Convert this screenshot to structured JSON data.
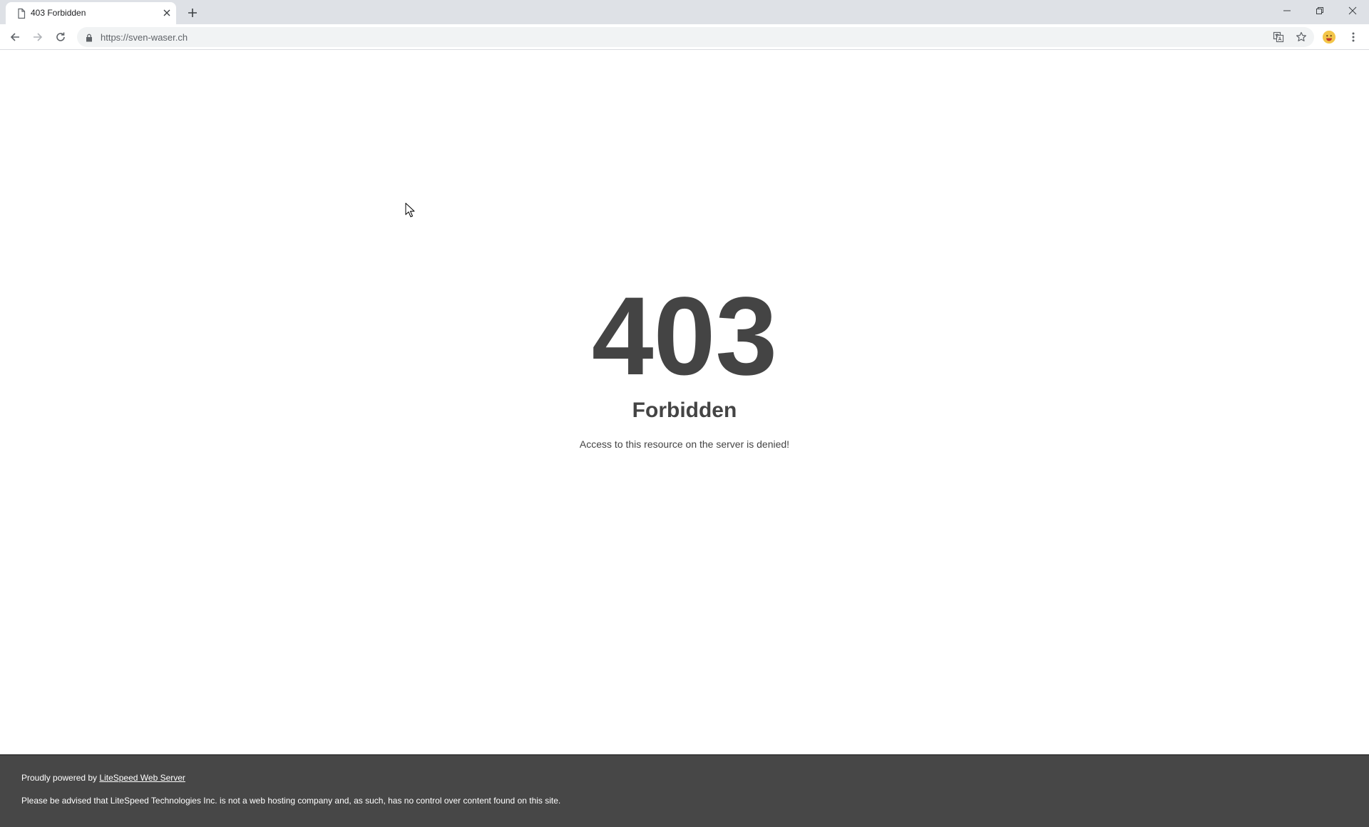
{
  "browser": {
    "tab": {
      "title": "403 Forbidden",
      "favicon": "document-icon"
    },
    "address_bar": {
      "url": "https://sven-waser.ch"
    },
    "icons": {
      "back": "arrow-left-icon",
      "forward": "arrow-right-icon",
      "reload": "reload-icon",
      "lock": "lock-icon",
      "translate": "translate-icon",
      "bookmark": "star-icon",
      "menu": "three-dots-icon",
      "new_tab": "plus-icon",
      "close_tab": "close-icon",
      "minimize": "minimize-icon",
      "restore": "restore-icon",
      "close_window": "close-icon"
    }
  },
  "page": {
    "error_code": "403",
    "error_title": "Forbidden",
    "error_description": "Access to this resource on the server is denied!"
  },
  "footer": {
    "powered_prefix": "Proudly powered by ",
    "powered_link": "LiteSpeed Web Server",
    "disclaimer": "Please be advised that LiteSpeed Technologies Inc. is not a web hosting company and, as such, has no control over content found on this site."
  },
  "colors": {
    "text": "#444444",
    "footer_bg": "#474747",
    "tabstrip_bg": "#dee1e6",
    "omnibox_bg": "#f1f3f4"
  }
}
